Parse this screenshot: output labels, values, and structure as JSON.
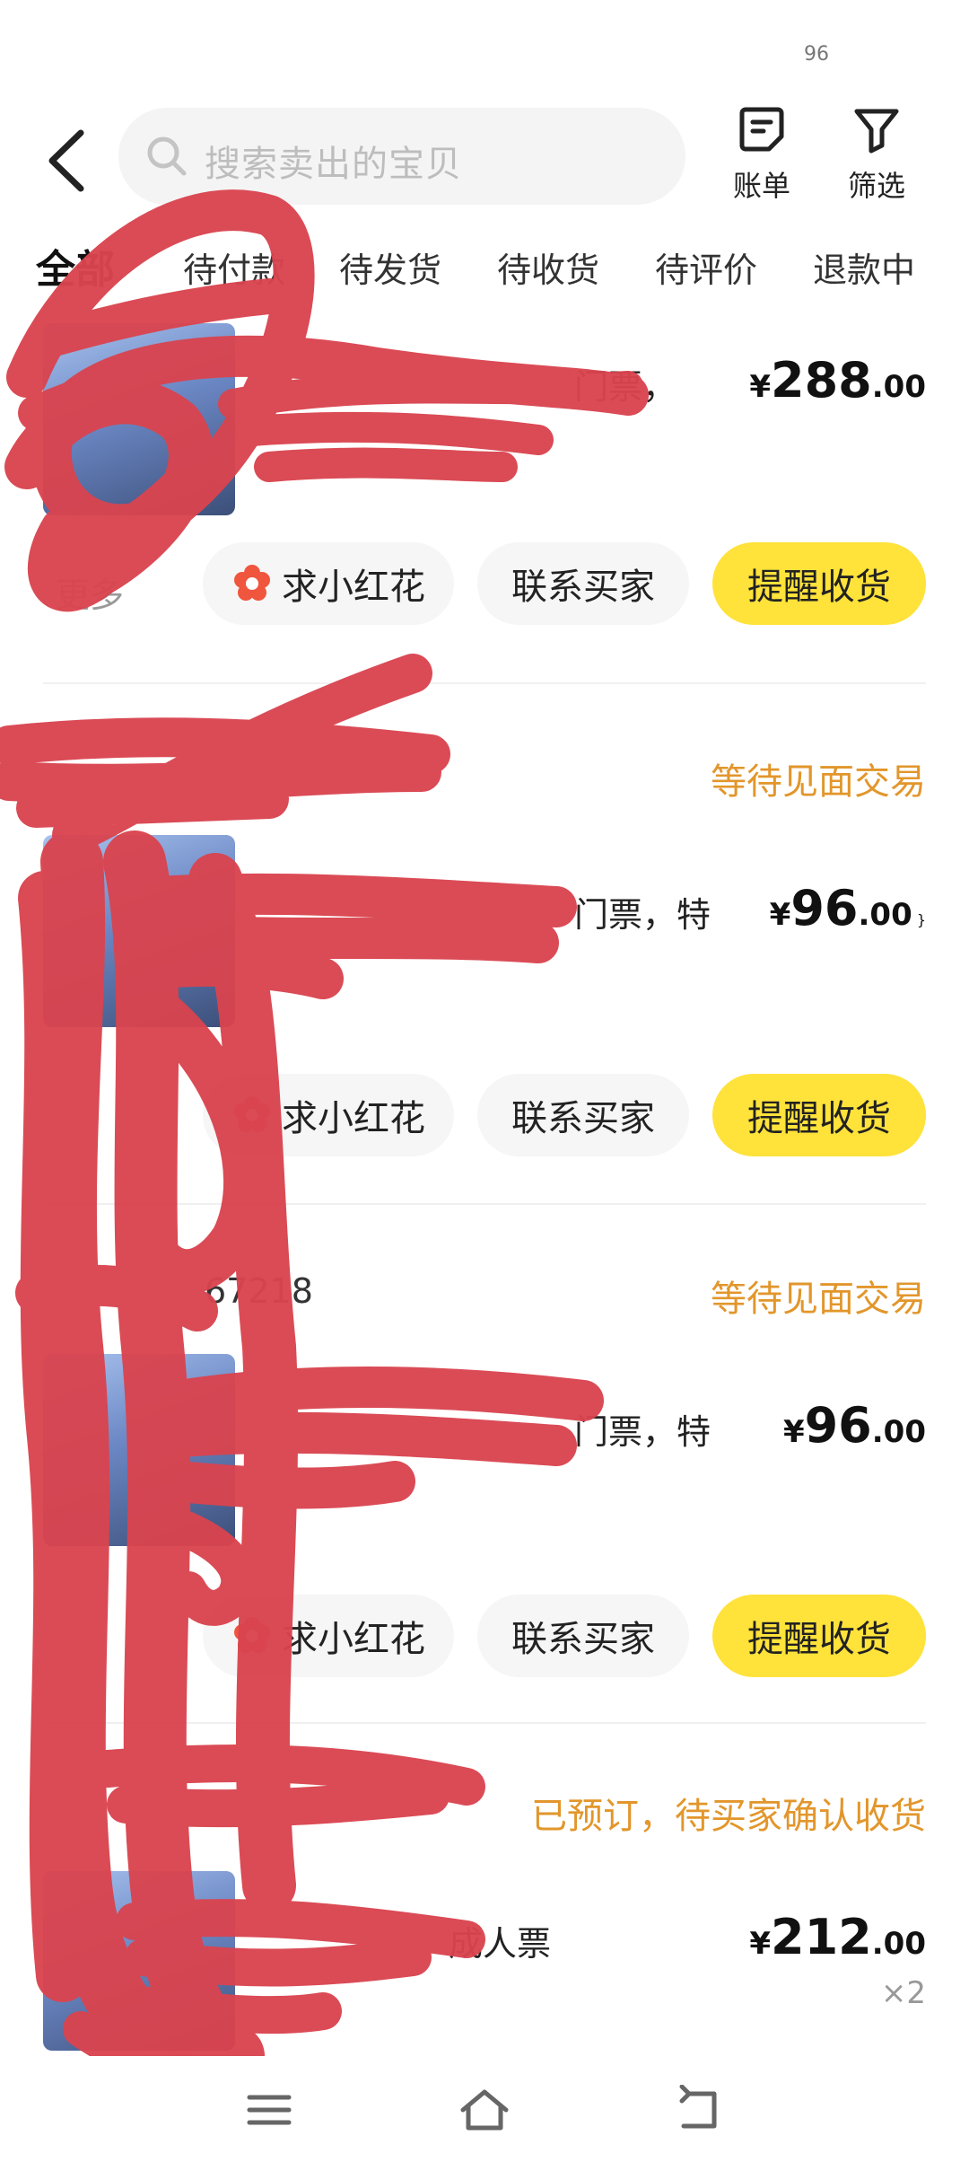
{
  "status_bar": {
    "battery": "96"
  },
  "header": {
    "search_placeholder": "搜索卖出的宝贝",
    "bill_label": "账单",
    "filter_label": "筛选"
  },
  "tabs": [
    "全部",
    "待付款",
    "待发货",
    "待收货",
    "待评价",
    "退款中"
  ],
  "active_tab": "全部",
  "orders": [
    {
      "title_fragment": "门票，",
      "price_currency": "¥",
      "price_int": "288",
      "price_dec": ".00",
      "more_label": "更多",
      "flower_label": "求小红花",
      "contact_label": "联系买家",
      "primary_label": "提醒收货"
    },
    {
      "status": "等待见面交易",
      "title_fragment": "门票，特",
      "price_currency": "¥",
      "price_int": "96",
      "price_dec": ".00",
      "flower_label": "求小红花",
      "contact_label": "联系买家",
      "primary_label": "提醒收货"
    },
    {
      "order_id_fragment": "67218",
      "status": "等待见面交易",
      "title_fragment": "门票，特",
      "price_currency": "¥",
      "price_int": "96",
      "price_dec": ".00",
      "flower_label": "求小红花",
      "contact_label": "联系买家",
      "primary_label": "提醒收货"
    },
    {
      "status": "已预订，待买家确认收货",
      "title_fragment": "成人票",
      "price_currency": "¥",
      "price_int": "212",
      "price_dec": ".00",
      "quantity": "×2"
    }
  ],
  "colors": {
    "accent_yellow": "#ffe23a",
    "status_orange": "#e2962b",
    "scribble_red": "#d9444f",
    "flower_red": "#f0553e"
  },
  "icons": {
    "back": "chevron-left-icon",
    "search": "search-icon",
    "bill": "bill-icon",
    "filter": "filter-icon",
    "flower": "flower-icon",
    "nav_menu": "menu-icon",
    "nav_home": "home-icon",
    "nav_back": "back-arrow-icon"
  }
}
